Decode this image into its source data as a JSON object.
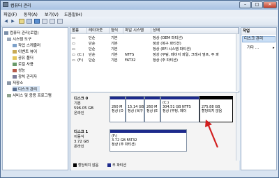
{
  "window": {
    "title": "컴퓨터 관리",
    "min": "–",
    "max": "□",
    "close": "✕"
  },
  "menu": [
    "파일(F)",
    "동작(A)",
    "보기(V)",
    "도움말(H)"
  ],
  "toolbar": {
    "back": "◀",
    "forward": "▶"
  },
  "tree": [
    {
      "label": "컴퓨터 관리(로컬)",
      "indent": 0,
      "icon": "computer-icon"
    },
    {
      "label": "시스템 도구",
      "indent": 1,
      "icon": "tools-icon"
    },
    {
      "label": "작업 스케줄러",
      "indent": 2,
      "icon": "clock-icon"
    },
    {
      "label": "이벤트 뷰어",
      "indent": 2,
      "icon": "event-icon"
    },
    {
      "label": "공유 폴더",
      "indent": 2,
      "icon": "folder-icon"
    },
    {
      "label": "로컬 사용",
      "indent": 2,
      "icon": "users-icon"
    },
    {
      "label": "성능",
      "indent": 2,
      "icon": "perf-icon"
    },
    {
      "label": "장치 관리자",
      "indent": 2,
      "icon": "device-icon"
    },
    {
      "label": "저장소",
      "indent": 1,
      "icon": "storage-icon"
    },
    {
      "label": "디스크 관리",
      "indent": 2,
      "icon": "disk-icon"
    },
    {
      "label": "서비스 및 응용 프로그램",
      "indent": 1,
      "icon": "services-icon"
    }
  ],
  "columns": [
    "볼륨",
    "레이아웃",
    "형식",
    "파일 시스템",
    "상태"
  ],
  "volumes": [
    {
      "vol": "",
      "layout": "단순",
      "type": "기본",
      "fs": "",
      "status": "정상 (OEM 파티션)"
    },
    {
      "vol": "",
      "layout": "단순",
      "type": "기본",
      "fs": "",
      "status": "정상 (복구 파티션)"
    },
    {
      "vol": "",
      "layout": "단순",
      "type": "기본",
      "fs": "",
      "status": "정상 (EFI 시스템 파티션)"
    },
    {
      "vol": "(C:)",
      "layout": "단순",
      "type": "기본",
      "fs": "NTFS",
      "status": "정상 (부팅, 페이지 파일, 크래시 덤프, 주 파"
    },
    {
      "vol": "(F:)",
      "layout": "단순",
      "type": "기본",
      "fs": "FAT32",
      "status": "정상 (주 파티션)"
    }
  ],
  "disk0": {
    "name": "디스크 0",
    "kind": "기본",
    "size": "596.05 GB",
    "state": "온라인",
    "parts": [
      {
        "l1": "260 M",
        "l2": "정상 (O"
      },
      {
        "l1": "15.14 GB",
        "l2": "정상 (복구"
      },
      {
        "l1": "260 M",
        "l2": "정상 (E"
      },
      {
        "l1": "(C:)",
        "l2": "304.51 GB NTFS",
        "l3": "정상 (부팅, 페이"
      },
      {
        "l1": "275.88 GB",
        "l2": "할당되지 않음"
      }
    ]
  },
  "disk1": {
    "name": "디스크 1",
    "kind": "이동식",
    "size": "3.72 GB",
    "state": "온라인",
    "part": {
      "l1": "(F:)",
      "l2": "3.72 GB FAT32",
      "l3": "정상 (주 파티션)"
    }
  },
  "legend": [
    "할당되지 않음",
    "주 파티션"
  ],
  "actions": {
    "header": "작업",
    "selected": "디스크 관리",
    "more": "기타 ..."
  },
  "colors": {
    "primary": "#1d2a8c",
    "unallocated": "#000000",
    "arrow": "#d21f1f"
  }
}
